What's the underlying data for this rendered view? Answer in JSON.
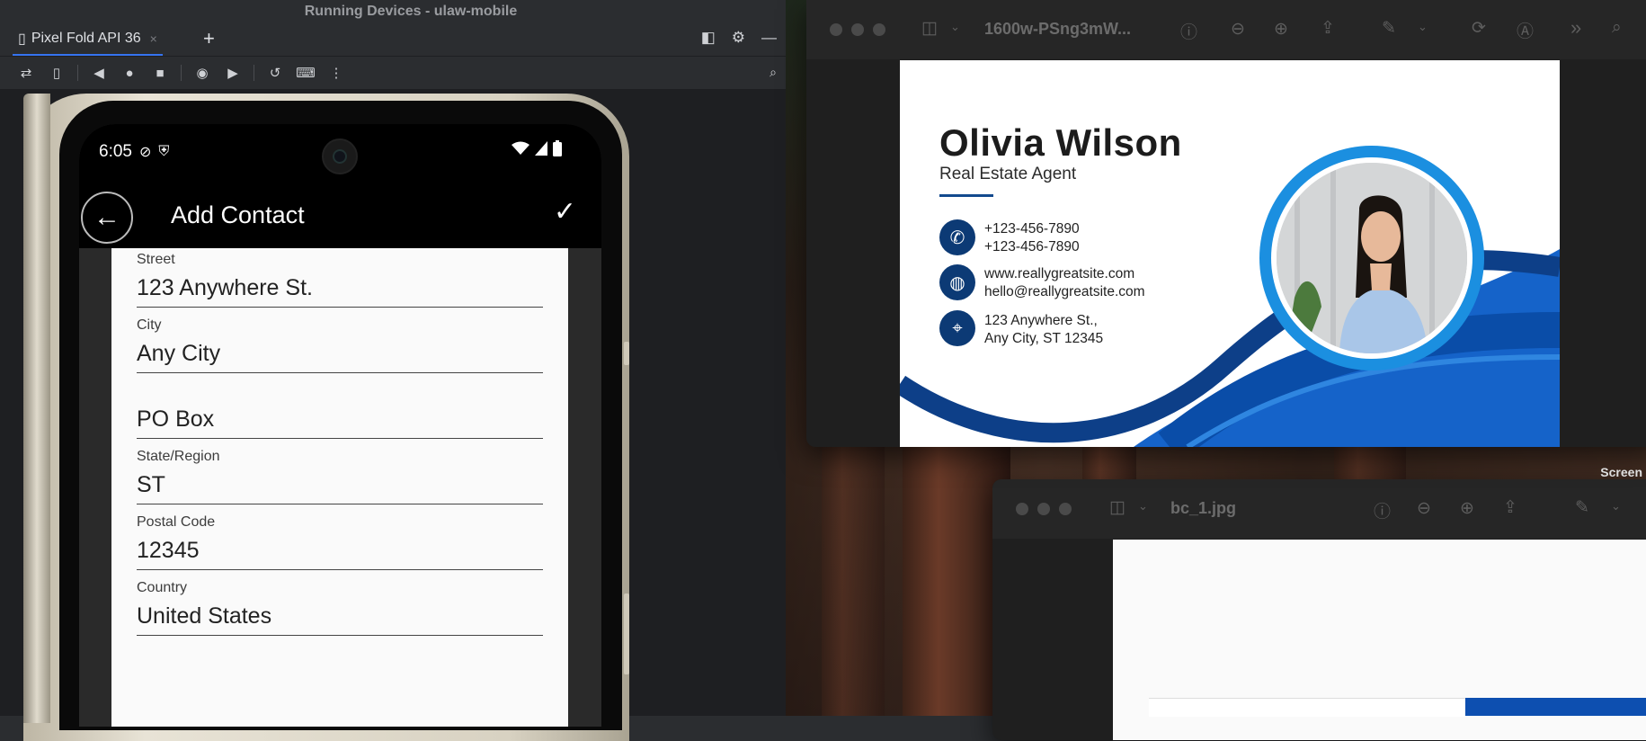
{
  "studio": {
    "title": "Running Devices - ulaw-mobile",
    "device_tab": "Pixel Fold API 36",
    "tab_close": "×",
    "tab_add": "+"
  },
  "phone": {
    "status_time": "6:05",
    "appbar_title": "Add Contact",
    "fields": [
      {
        "label": "Street",
        "value": "123 Anywhere St."
      },
      {
        "label": "City",
        "value": "Any City"
      },
      {
        "label": "",
        "value": "PO Box"
      },
      {
        "label": "State/Region",
        "value": "ST"
      },
      {
        "label": "Postal Code",
        "value": "12345"
      },
      {
        "label": "Country",
        "value": "United States"
      }
    ]
  },
  "preview1": {
    "title": "1600w-PSng3mW..."
  },
  "card": {
    "name": "Olivia Wilson",
    "role": "Real Estate Agent",
    "phone1": "+123-456-7890",
    "phone2": "+123-456-7890",
    "web": "www.reallygreatsite.com",
    "email": "hello@reallygreatsite.com",
    "address1": "123 Anywhere St.,",
    "address2": "Any City, ST 12345",
    "accent": "#0c3a75",
    "ring": "#1b8fe0"
  },
  "preview2": {
    "title": "bc_1.jpg"
  },
  "desktop": {
    "screen_label": "Screen"
  }
}
